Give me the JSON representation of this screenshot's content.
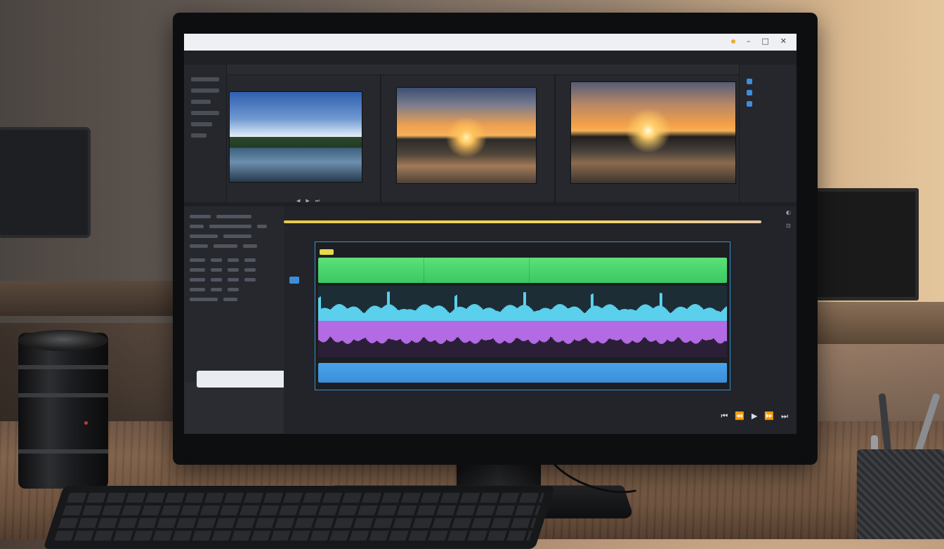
{
  "app": {
    "title_bar": "",
    "window_controls": [
      "–",
      "□",
      "✕"
    ],
    "menu": [
      "",
      "",
      "",
      "",
      "",
      "",
      ""
    ]
  },
  "viewers": [
    {
      "name": "",
      "timecode": "",
      "controls": [
        "◀",
        "▶",
        "⏭"
      ]
    },
    {
      "name": "",
      "timecode": "",
      "controls": [
        "◀",
        "▶",
        "⏭"
      ]
    },
    {
      "name": "",
      "timecode": "",
      "controls": [
        "◀",
        "▶",
        "⏭"
      ]
    }
  ],
  "right_panel": {
    "items": [
      "",
      "",
      ""
    ]
  },
  "timeline": {
    "ruler_ticks": [
      "",
      "",
      "",
      "",
      "",
      "",
      ""
    ],
    "track_headers": [
      "",
      "",
      "",
      "",
      "",
      "",
      "",
      ""
    ]
  },
  "transport": {
    "buttons": [
      "⏮",
      "⏪",
      "▶",
      "⏩",
      "⏭"
    ]
  },
  "colors": {
    "green_track": "#48d56c",
    "audio_cyan": "#5ad0ec",
    "audio_purple": "#b26be3",
    "blue_track": "#3a8fd9",
    "playhead": "#e5c94a",
    "accent": "#3a8fc8"
  },
  "icons": [
    "close-icon",
    "minimize-icon",
    "maximize-icon",
    "play-icon",
    "rewind-icon",
    "forward-icon",
    "search-icon"
  ]
}
